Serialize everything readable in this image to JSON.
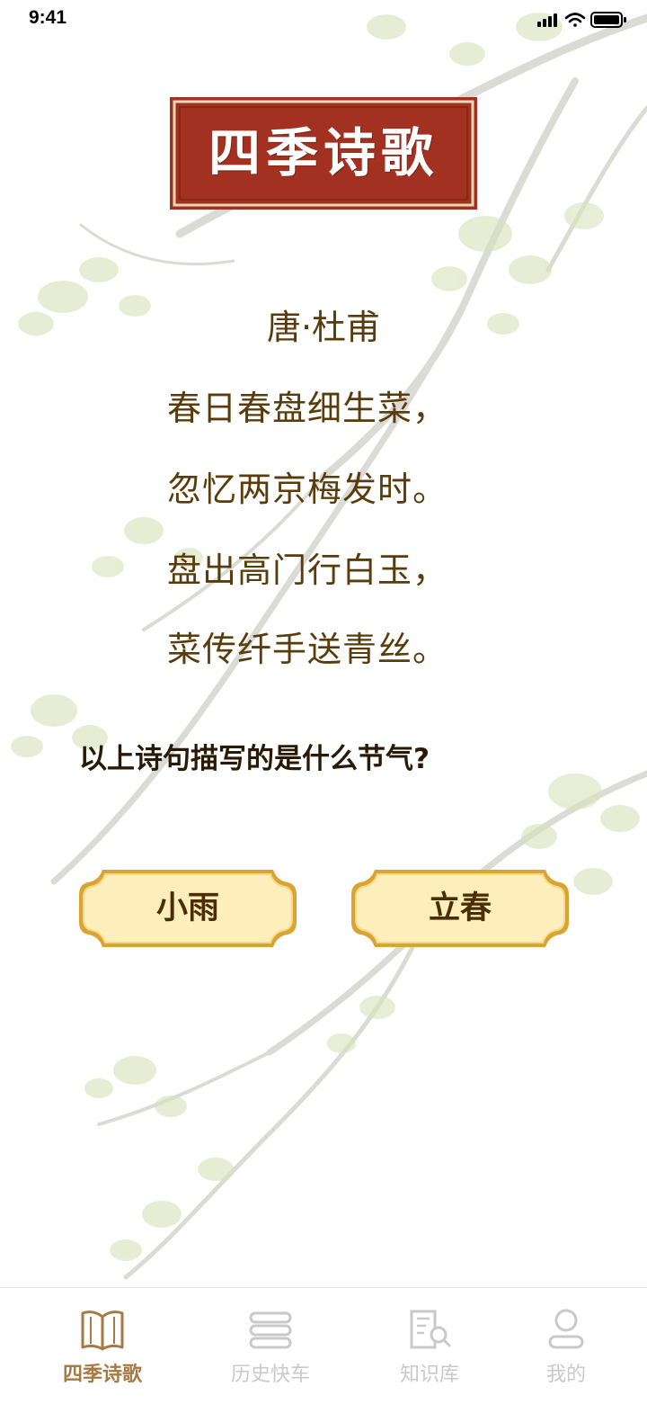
{
  "status_bar": {
    "time": "9:41",
    "icons": [
      "signal-icon",
      "wifi-icon",
      "battery-icon"
    ]
  },
  "banner": {
    "title": "四季诗歌"
  },
  "poem": {
    "author": "唐·杜甫",
    "lines": [
      "春日春盘细生菜，",
      "忽忆两京梅发时。",
      "盘出高门行白玉，",
      "菜传纤手送青丝。"
    ]
  },
  "question": "以上诗句描写的是什么节气?",
  "answers": [
    {
      "label": "小雨"
    },
    {
      "label": "立春"
    }
  ],
  "tab_bar": {
    "tabs": [
      {
        "label": "四季诗歌",
        "icon": "book-icon",
        "active": true
      },
      {
        "label": "历史快车",
        "icon": "stack-icon",
        "active": false
      },
      {
        "label": "知识库",
        "icon": "library-search-icon",
        "active": false
      },
      {
        "label": "我的",
        "icon": "user-icon",
        "active": false
      }
    ]
  },
  "colors": {
    "banner_red": "#a33121",
    "text_brown": "#5a3b0c",
    "button_fill": "#fdeebc",
    "button_border": "#d4a22a",
    "tab_active": "#a67a43",
    "tab_inactive": "#c9c9c9"
  }
}
